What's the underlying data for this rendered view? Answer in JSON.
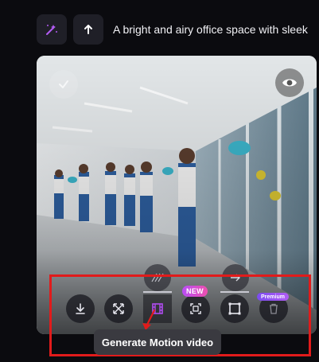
{
  "prompt": {
    "text": "A bright and airy office space with sleek"
  },
  "icons": {
    "magic": "magic-wand-icon",
    "upload": "arrow-up-icon",
    "check": "check-icon",
    "eye": "eye-icon",
    "download": "download-icon",
    "expand": "expand-icon",
    "motion": "film-icon",
    "scan": "face-scan-icon",
    "crop": "crop-frame-icon",
    "delete": "trash-icon"
  },
  "toolbar": {
    "new_badge": "NEW",
    "premium_badge": "Premium"
  },
  "tooltip": {
    "text": "Generate Motion video"
  },
  "colors": {
    "highlight": "#e11b1b",
    "active_icon": "#b04cf0",
    "new_badge": "#d94ed0",
    "premium_badge": "#8a52f2"
  }
}
